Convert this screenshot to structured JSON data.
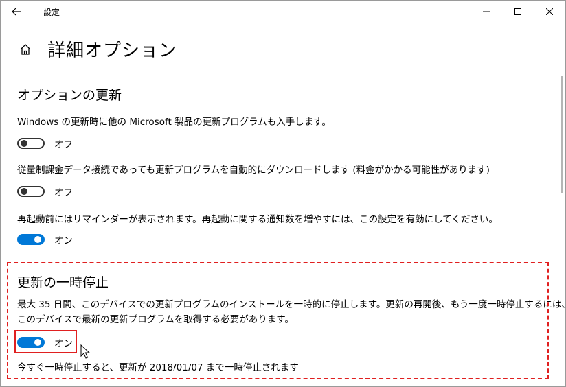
{
  "window": {
    "title": "設定"
  },
  "page": {
    "title": "詳細オプション"
  },
  "update_options": {
    "heading": "オプションの更新",
    "items": [
      {
        "description": "Windows の更新時に他の Microsoft 製品の更新プログラムも入手します。",
        "state": "off",
        "state_label": "オフ"
      },
      {
        "description": "従量制課金データ接続であっても更新プログラムを自動的にダウンロードします (料金がかかる可能性があります)",
        "state": "off",
        "state_label": "オフ"
      },
      {
        "description": "再起動前にはリマインダーが表示されます。再起動に関する通知数を増やすには、この設定を有効にしてください。",
        "state": "on",
        "state_label": "オン"
      }
    ]
  },
  "pause_updates": {
    "heading": "更新の一時停止",
    "description_line1": "最大 35 日間、このデバイスでの更新プログラムのインストールを一時的に停止します。更新の再開後、もう一度一時停止するには、",
    "description_line2": "このデバイスで最新の更新プログラムを取得する必要があります。",
    "state": "on",
    "state_label": "オン",
    "note": "今すぐ一時停止すると、更新が 2018/01/07 まで一時停止されます"
  },
  "colors": {
    "accent": "#0078d7",
    "annotation": "#e02020"
  }
}
